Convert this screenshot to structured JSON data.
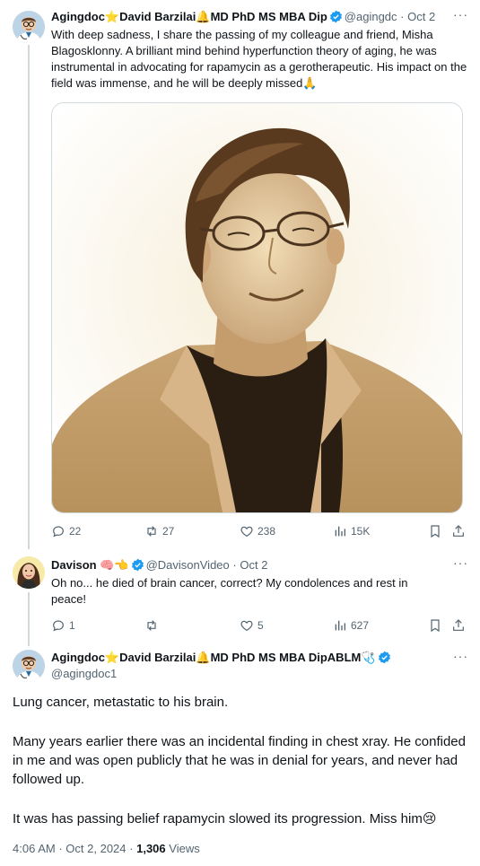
{
  "tweet1": {
    "name": "Agingdoc⭐David Barzilai🔔MD PhD MS MBA Dip",
    "handle": "@agingdc",
    "separator": "·",
    "date": "Oct 2",
    "text": "With deep sadness, I share the passing of my colleague and friend, Misha Blagosklonny. A brilliant mind behind hyperfunction theory of aging, he was instrumental in advocating for rapamycin as a gerotherapeutic. His impact on the field was immense, and he will be deeply missed🙏",
    "replies": "22",
    "reposts": "27",
    "likes": "238",
    "views": "15K"
  },
  "tweet2": {
    "name": "Davison",
    "name_emoji": "🧠👈",
    "handle": "@DavisonVideo",
    "separator": "·",
    "date": "Oct 2",
    "text": "Oh no... he died of brain cancer, correct? My condolences and rest in peace!",
    "replies": "1",
    "reposts": "",
    "likes": "5",
    "views": "627"
  },
  "tweet3": {
    "name": "Agingdoc⭐David Barzilai🔔MD PhD MS MBA DipABLM🩺",
    "handle": "@agingdoc1",
    "para1": "Lung cancer, metastatic to his brain.",
    "para2": "Many years earlier there was an incidental finding in chest xray. He confided in me and was open publicly that he was in denial for years, and never had followed up.",
    "para3": "It was has passing belief rapamycin slowed its progression. Miss him😢",
    "time": "4:06 AM",
    "separator": "·",
    "date": "Oct 2, 2024",
    "views_count": "1,306",
    "views_label": "Views"
  },
  "colors": {
    "verified": "#1d9bf0",
    "muted": "#536471",
    "sepia_bg": "#efe2c2",
    "sepia_dark": "#3a2a17"
  }
}
